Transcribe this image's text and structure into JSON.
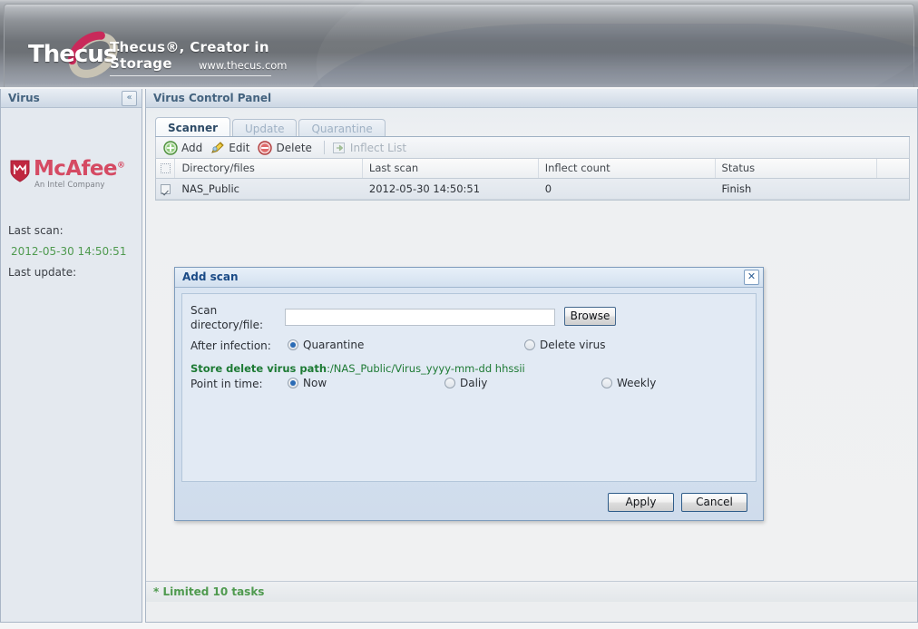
{
  "banner": {
    "brand": "Thecus",
    "brand_sup": "·",
    "tagline": "Thecus®, Creator in Storage",
    "url": "www.thecus.com"
  },
  "sidebar": {
    "title": "Virus",
    "collapse_icon": "«",
    "vendor": {
      "name": "McAfee",
      "name_sup": "®",
      "subtitle": "An Intel Company"
    },
    "last_scan_label": "Last scan:",
    "last_scan_value": "2012-05-30 14:50:51",
    "last_update_label": "Last update:"
  },
  "main": {
    "title": "Virus Control Panel",
    "tabs": [
      {
        "label": "Scanner",
        "active": true
      },
      {
        "label": "Update",
        "active": false
      },
      {
        "label": "Quarantine",
        "active": false
      }
    ],
    "toolbar": [
      {
        "label": "Add",
        "icon": "plus-circle-icon",
        "disabled": false
      },
      {
        "label": "Edit",
        "icon": "pencil-icon",
        "disabled": false
      },
      {
        "label": "Delete",
        "icon": "minus-circle-icon",
        "disabled": false
      },
      {
        "label": "Inflect List",
        "icon": "export-list-icon",
        "disabled": true
      }
    ],
    "table": {
      "columns": [
        "Directory/files",
        "Last scan",
        "Inflect count",
        "Status"
      ],
      "rows": [
        {
          "checked": true,
          "directory": "NAS_Public",
          "last_scan": "2012-05-30 14:50:51",
          "inflect_count": "0",
          "status": "Finish"
        }
      ]
    },
    "footnote": "* Limited 10 tasks"
  },
  "modal": {
    "title": "Add scan",
    "close_icon": "✕",
    "scan_dir_label_1": "Scan",
    "scan_dir_label_2": "directory/file:",
    "scan_dir_value": "",
    "scan_dir_placeholder": "",
    "browse_label": "Browse",
    "after_infection_label": "After infection:",
    "after_infection_options": [
      {
        "label": "Quarantine",
        "selected": true
      },
      {
        "label": "Delete virus",
        "selected": false
      }
    ],
    "store_path_label": "Store delete virus path",
    "store_path_value": ":/NAS_Public/Virus_yyyy-mm-dd hhssii",
    "point_in_time_label": "Point in time:",
    "point_in_time_options": [
      {
        "label": "Now",
        "selected": true
      },
      {
        "label": "Daliy",
        "selected": false
      },
      {
        "label": "Weekly",
        "selected": false
      }
    ],
    "apply_label": "Apply",
    "cancel_label": "Cancel"
  },
  "colors": {
    "accent_blue": "#1a4a86",
    "panel_title": "#44637f",
    "green_text": "#4f9a4f",
    "path_green": "#1d7a34",
    "mcafee_red": "#d54a63"
  }
}
